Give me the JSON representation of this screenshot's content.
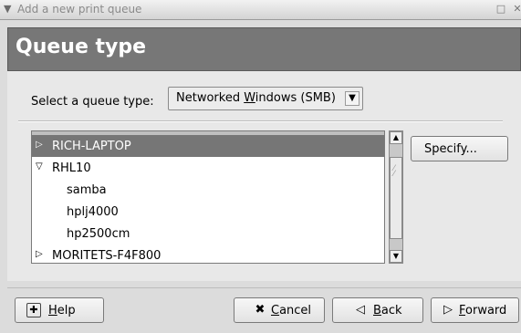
{
  "window": {
    "title": "Add a new print queue",
    "menu_icon": "chevron-down-icon",
    "maximize_icon": "maximize-icon",
    "close_icon": "close-icon"
  },
  "banner": {
    "heading": "Queue type"
  },
  "queue_select": {
    "label": "Select a queue type:",
    "value_prefix": "Networked ",
    "value_mnemonic": "W",
    "value_suffix": "indows (SMB)"
  },
  "tree": {
    "items": [
      {
        "label": "RICH-LAPTOP",
        "expander": "collapsed",
        "selected": true,
        "level": 0
      },
      {
        "label": "RHL10",
        "expander": "expanded",
        "selected": false,
        "level": 0
      },
      {
        "label": "samba",
        "expander": "",
        "selected": false,
        "level": 1
      },
      {
        "label": "hplj4000",
        "expander": "",
        "selected": false,
        "level": 1
      },
      {
        "label": "hp2500cm",
        "expander": "",
        "selected": false,
        "level": 1
      },
      {
        "label": "MORITETS-F4F800",
        "expander": "collapsed",
        "selected": false,
        "level": 0
      }
    ]
  },
  "specify_button": {
    "label": "Specify..."
  },
  "buttons": {
    "help": {
      "mnemonic": "H",
      "rest": "elp",
      "icon": "help-icon"
    },
    "cancel": {
      "mnemonic": "C",
      "rest": "ancel",
      "icon": "cancel-icon"
    },
    "back": {
      "mnemonic": "B",
      "rest": "ack",
      "icon": "back-arrow-icon"
    },
    "forward": {
      "mnemonic": "F",
      "rest": "orward",
      "icon": "forward-arrow-icon"
    }
  }
}
